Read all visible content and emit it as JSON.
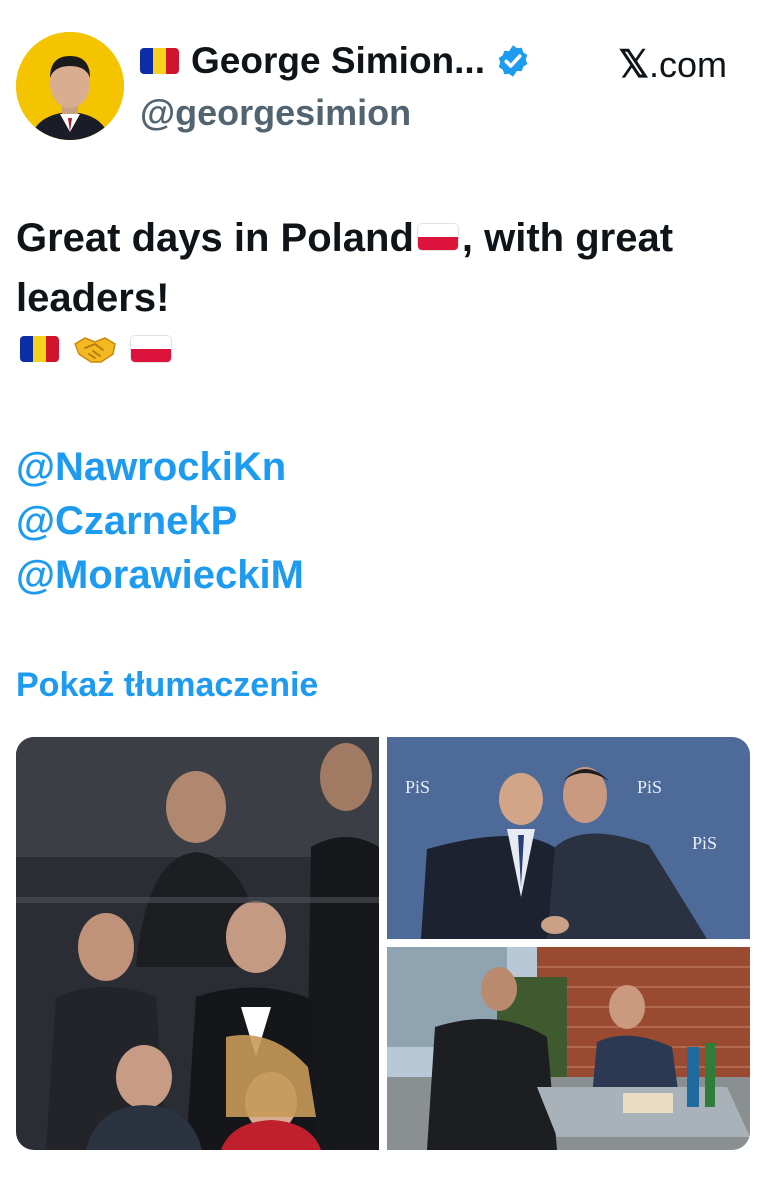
{
  "author": {
    "display_name": "George Simion...",
    "handle": "@georgesimion",
    "verified": true,
    "name_flag": "romania-flag"
  },
  "source": {
    "x_logo": "𝕏",
    "label": ".com"
  },
  "tweet": {
    "text_part1": "Great days in Poland",
    "text_part2": ", with great leaders!",
    "emojis": [
      "romania-flag",
      "handshake",
      "poland-flag"
    ],
    "mentions": [
      "@NawrockiKn",
      "@CzarnekP",
      "@MorawieckiM"
    ],
    "translate_label": "Pokaż tłumaczenie"
  },
  "media": {
    "photos": [
      {
        "name": "stadium-crowd-photo"
      },
      {
        "name": "pis-meeting-photo",
        "logo_text": "PiS"
      },
      {
        "name": "outdoor-cafe-photo"
      }
    ]
  },
  "colors": {
    "link": "#1d9bf0",
    "handle": "#536471",
    "text": "#0f1419",
    "verified": "#1d9bf0",
    "avatar_bg": "#f5c400"
  }
}
